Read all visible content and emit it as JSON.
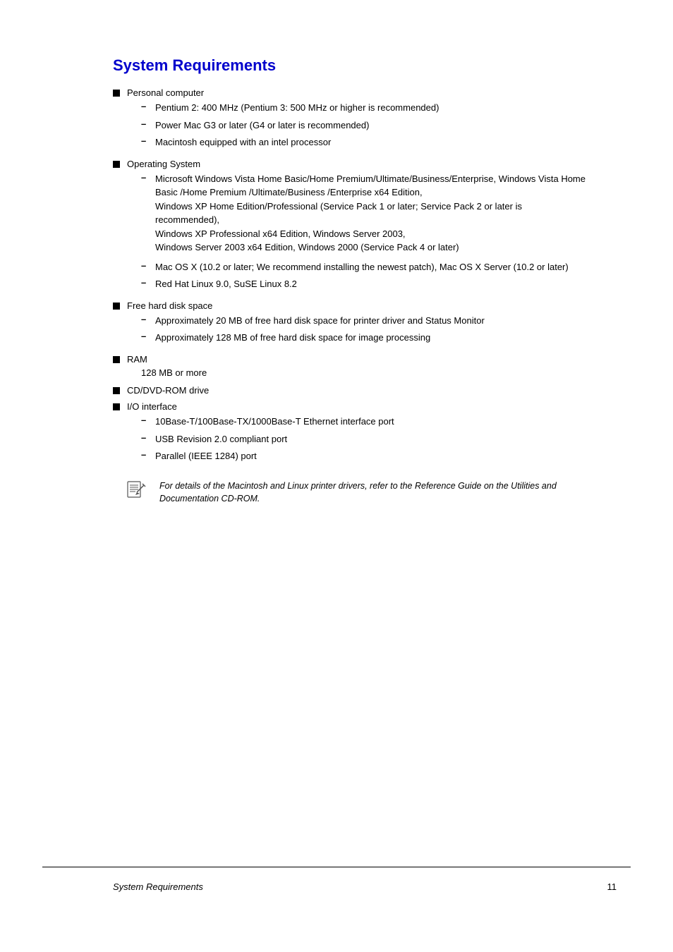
{
  "page": {
    "title": "System Requirements",
    "title_color": "#0000cc",
    "items": [
      {
        "label": "Personal computer",
        "subitems": [
          "Pentium 2: 400 MHz (Pentium 3: 500 MHz or higher is recommended)",
          "Power Mac G3 or later (G4 or later is recommended)",
          "Macintosh equipped with an intel processor"
        ]
      },
      {
        "label": "Operating System",
        "subitems": [
          "Microsoft Windows Vista Home Basic/Home Premium/Ultimate/Business/Enterprise, Windows Vista Home Basic /Home Premium /Ultimate/Business /Enterprise x64 Edition,\nWindows XP Home Edition/Professional (Service Pack 1 or later; Service Pack 2 or later is recommended),\nWindows XP Professional x64 Edition, Windows Server 2003,\nWindows Server 2003 x64 Edition, Windows 2000 (Service Pack 4 or later)",
          "Mac OS X (10.2 or later; We recommend installing the newest patch), Mac OS X Server (10.2 or later)",
          "Red Hat Linux 9.0, SuSE Linux 8.2"
        ]
      },
      {
        "label": "Free hard disk space",
        "subitems": [
          "Approximately 20 MB of free hard disk space for printer driver and Status Monitor",
          "Approximately 128 MB of free hard disk space for image processing"
        ]
      },
      {
        "label": "RAM",
        "ram_detail": "128 MB or more",
        "subitems": []
      },
      {
        "label": "CD/DVD-ROM drive",
        "subitems": []
      },
      {
        "label": "I/O interface",
        "subitems": [
          "10Base-T/100Base-TX/1000Base-T Ethernet interface port",
          "USB Revision 2.0 compliant port",
          "Parallel (IEEE 1284) port"
        ]
      }
    ],
    "note": "For details of the Macintosh and Linux printer drivers, refer to the Reference Guide on the Utilities and Documentation CD-ROM.",
    "footer_left": "System Requirements",
    "footer_right": "11"
  }
}
